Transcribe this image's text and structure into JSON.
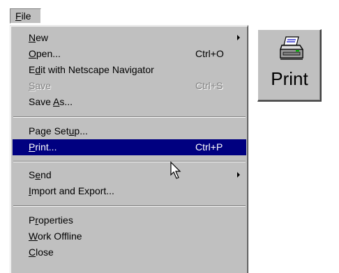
{
  "menubar": {
    "file_label": "File",
    "file_mnemonic": "F",
    "file_rest": "ile"
  },
  "menu": {
    "items": [
      {
        "id": "new",
        "label_pre": "",
        "mnemonic": "N",
        "label_post": "ew",
        "shortcut": "",
        "submenu": true,
        "disabled": false,
        "selected": false
      },
      {
        "id": "open",
        "label_pre": "",
        "mnemonic": "O",
        "label_post": "pen...",
        "shortcut": "Ctrl+O",
        "submenu": false,
        "disabled": false,
        "selected": false
      },
      {
        "id": "edit-with-netscape",
        "label_pre": "E",
        "mnemonic": "d",
        "label_post": "it with Netscape Navigator",
        "shortcut": "",
        "submenu": false,
        "disabled": false,
        "selected": false
      },
      {
        "id": "save",
        "label_pre": "",
        "mnemonic": "S",
        "label_post": "ave",
        "shortcut": "Ctrl+S",
        "submenu": false,
        "disabled": true,
        "selected": false
      },
      {
        "id": "save-as",
        "label_pre": "Save ",
        "mnemonic": "A",
        "label_post": "s...",
        "shortcut": "",
        "submenu": false,
        "disabled": false,
        "selected": false
      },
      {
        "id": "page-setup",
        "label_pre": "Page Set",
        "mnemonic": "u",
        "label_post": "p...",
        "shortcut": "",
        "submenu": false,
        "disabled": false,
        "selected": false
      },
      {
        "id": "print",
        "label_pre": "",
        "mnemonic": "P",
        "label_post": "rint...",
        "shortcut": "Ctrl+P",
        "submenu": false,
        "disabled": false,
        "selected": true
      },
      {
        "id": "send",
        "label_pre": "S",
        "mnemonic": "e",
        "label_post": "nd",
        "shortcut": "",
        "submenu": true,
        "disabled": false,
        "selected": false
      },
      {
        "id": "import-export",
        "label_pre": "",
        "mnemonic": "I",
        "label_post": "mport and Export...",
        "shortcut": "",
        "submenu": false,
        "disabled": false,
        "selected": false
      },
      {
        "id": "properties",
        "label_pre": "P",
        "mnemonic": "r",
        "label_post": "operties",
        "shortcut": "",
        "submenu": false,
        "disabled": false,
        "selected": false
      },
      {
        "id": "work-offline",
        "label_pre": "",
        "mnemonic": "W",
        "label_post": "ork Offline",
        "shortcut": "",
        "submenu": false,
        "disabled": false,
        "selected": false
      },
      {
        "id": "close",
        "label_pre": "",
        "mnemonic": "C",
        "label_post": "lose",
        "shortcut": "",
        "submenu": false,
        "disabled": false,
        "selected": false
      }
    ]
  },
  "toolbar": {
    "print_label": "Print",
    "print_icon": "printer-icon"
  },
  "colors": {
    "menu_bg": "#c0c0c0",
    "highlight": "#000080",
    "highlight_text": "#ffffff",
    "disabled_text": "#808080"
  }
}
